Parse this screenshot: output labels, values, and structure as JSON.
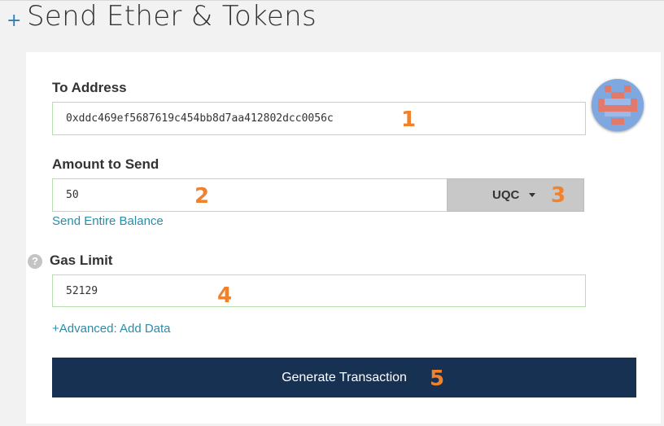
{
  "header": {
    "plus_symbol": "+",
    "title": "Send Ether & Tokens"
  },
  "form": {
    "to_address": {
      "label": "To Address",
      "value": "0xddc469ef5687619c454bb8d7aa412802dcc0056c"
    },
    "amount": {
      "label": "Amount to Send",
      "value": "50",
      "token": "UQC",
      "send_entire_balance": "Send Entire Balance"
    },
    "gas": {
      "label": "Gas Limit",
      "help_symbol": "?",
      "value": "52129"
    },
    "advanced_link": "+Advanced: Add Data",
    "generate_button": "Generate Transaction"
  },
  "annotations": {
    "n1": "1",
    "n2": "2",
    "n3": "3",
    "n4": "4",
    "n5": "5"
  },
  "colors": {
    "accent_link": "#2b8ca8",
    "button_bg": "#163151",
    "annotation": "#f0822d",
    "field_border": "#b8deb0"
  }
}
